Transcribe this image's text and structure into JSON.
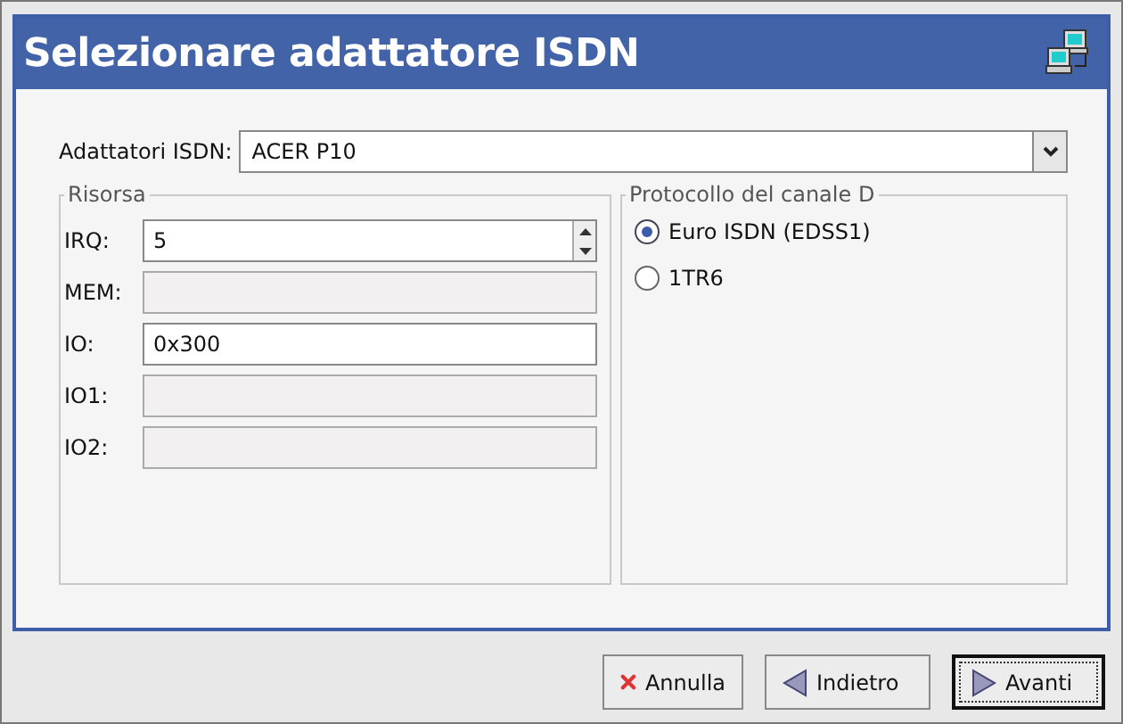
{
  "window": {
    "title": "Selezionare adattatore ISDN"
  },
  "adapter": {
    "label": "Adattatori ISDN:",
    "value": "ACER P10"
  },
  "resource": {
    "title": "Risorsa",
    "fields": [
      {
        "label": "IRQ:",
        "value": "5",
        "kind": "spin",
        "disabled": false
      },
      {
        "label": "MEM:",
        "kind": "text",
        "disabled": true
      },
      {
        "label": "IO:",
        "value": "0x300",
        "kind": "text",
        "disabled": false
      },
      {
        "label": "IO1:",
        "kind": "text",
        "disabled": true
      },
      {
        "label": "IO2:",
        "kind": "text",
        "disabled": true
      }
    ]
  },
  "protocol": {
    "title": "Protocollo del canale D",
    "options": [
      {
        "label": "Euro ISDN (EDSS1)",
        "selected": true
      },
      {
        "label": "1TR6",
        "selected": false
      }
    ]
  },
  "buttons": [
    {
      "label": "Annulla",
      "kind": "cancel",
      "focused": false
    },
    {
      "label": "Indietro",
      "kind": "back",
      "focused": false
    },
    {
      "label": "Avanti",
      "kind": "forward",
      "focused": true
    }
  ]
}
